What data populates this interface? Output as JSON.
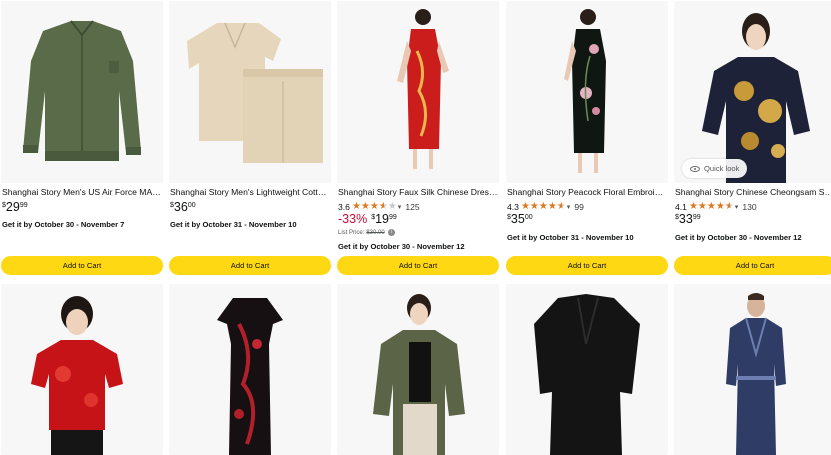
{
  "products": [
    {
      "title": "Shanghai Story Men's US Air Force MA-1...",
      "price": {
        "currency": "$",
        "whole": "29",
        "fraction": "99"
      },
      "delivery": "Get it by October 30 - November 7",
      "button": "Add to Cart",
      "image_icon": "bomber-jacket-image"
    },
    {
      "title": "Shanghai Story Men's Lightweight Cotton...",
      "price": {
        "currency": "$",
        "whole": "36",
        "fraction": "00"
      },
      "delivery": "Get it by October 31 - November 10",
      "button": "Add to Cart",
      "image_icon": "shirt-and-shorts-image"
    },
    {
      "title": "Shanghai Story Faux Silk Chinese Dress...",
      "rating": "3.6",
      "rating_value": 3.6,
      "review_count": "125",
      "discount": "-33%",
      "price": {
        "currency": "$",
        "whole": "19",
        "fraction": "99"
      },
      "list_price_label": "List Price:",
      "list_price": "$30.00",
      "delivery": "Get it by October 30 - November 12",
      "button": "Add to Cart",
      "image_icon": "red-qipao-image"
    },
    {
      "title": "Shanghai Story Peacock Floral Embroidery...",
      "rating": "4.3",
      "rating_value": 4.3,
      "review_count": "99",
      "price": {
        "currency": "$",
        "whole": "35",
        "fraction": "00"
      },
      "delivery": "Get it by October 31 - November 10",
      "button": "Add to Cart",
      "image_icon": "black-floral-qipao-image"
    },
    {
      "title": "Shanghai Story Chinese Cheongsam Shirt...",
      "rating": "4.1",
      "rating_value": 4.1,
      "review_count": "130",
      "price": {
        "currency": "$",
        "whole": "33",
        "fraction": "99"
      },
      "delivery": "Get it by October 30 - November 12",
      "button": "Add to Cart",
      "quick_look": "Quick look",
      "image_icon": "gold-cheongsam-shirt-image"
    }
  ],
  "row2_images": [
    "red-satin-blouse-image",
    "black-red-floral-qipao-image",
    "olive-jacket-image",
    "black-robe-image",
    "blue-paisley-robe-image"
  ],
  "colors": {
    "button": "#ffd814",
    "star": "#de7921",
    "discount": "#cc0c39",
    "image_bg": "#f7f7f7"
  }
}
